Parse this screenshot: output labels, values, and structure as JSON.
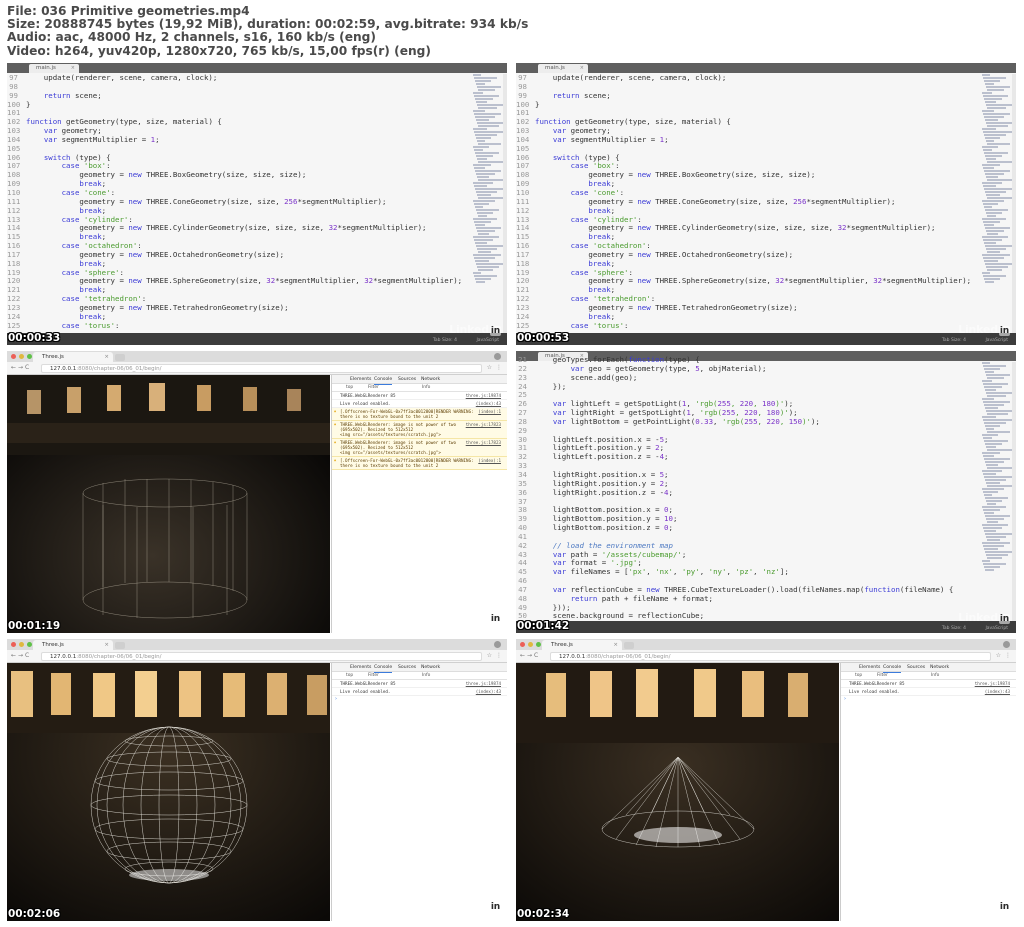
{
  "header": {
    "line1": "File: 036 Primitive geometries.mp4",
    "line2": "Size: 20888745 bytes (19,92 MiB), duration: 00:02:59, avg.bitrate: 934 kb/s",
    "line3": "Audio: aac, 48000 Hz, 2 channels, s16, 160 kb/s (eng)",
    "line4": "Video: h264, yuv420p, 1280x720, 765 kb/s, 15,00 fps(r) (eng)"
  },
  "watermark": {
    "text": "Linked",
    "badge": "in"
  },
  "editor": {
    "tab_label": "main.js",
    "status_left": "Tab Size: 4",
    "status_right": "JavaScript"
  },
  "browser": {
    "tab_label": "Three.js",
    "url_host": "127.0.0.1",
    "url_path": ":8080/chapter-06/06_01/begin/",
    "dev_tabs": [
      "Elements",
      "Console",
      "Sources",
      "Network"
    ],
    "filter_context": "top",
    "filter_placeholder": "Filter",
    "filter_level": "Info",
    "log_renderer": "THREE.WebGLRenderer 85",
    "log_renderer_src": "three.js:19874",
    "log_reload": "Live reload enabled.",
    "log_reload_src": "(index):43"
  },
  "thumbs": [
    {
      "timestamp": "00:00:33"
    },
    {
      "timestamp": "00:00:53"
    },
    {
      "timestamp": "00:01:19"
    },
    {
      "timestamp": "00:01:42"
    },
    {
      "timestamp": "00:02:06"
    },
    {
      "timestamp": "00:02:34"
    }
  ],
  "code_a": [
    {
      "n": "97",
      "t": "    update(renderer, scene, camera, clock);"
    },
    {
      "n": "98",
      "t": ""
    },
    {
      "n": "99",
      "t": "    return scene;"
    },
    {
      "n": "100",
      "t": "}"
    },
    {
      "n": "101",
      "t": ""
    },
    {
      "n": "102",
      "t": "function getGeometry(type, size, material) {"
    },
    {
      "n": "103",
      "t": "    var geometry;"
    },
    {
      "n": "104",
      "t": "    var segmentMultiplier = 1;"
    },
    {
      "n": "105",
      "t": ""
    },
    {
      "n": "106",
      "t": "    switch (type) {"
    },
    {
      "n": "107",
      "t": "        case 'box':"
    },
    {
      "n": "108",
      "t": "            geometry = new THREE.BoxGeometry(size, size, size);"
    },
    {
      "n": "109",
      "t": "            break;"
    },
    {
      "n": "110",
      "t": "        case 'cone':"
    },
    {
      "n": "111",
      "t": "            geometry = new THREE.ConeGeometry(size, size, 256*segmentMultiplier);"
    },
    {
      "n": "112",
      "t": "            break;"
    },
    {
      "n": "113",
      "t": "        case 'cylinder':"
    },
    {
      "n": "114",
      "t": "            geometry = new THREE.CylinderGeometry(size, size, size, 32*segmentMultiplier);"
    },
    {
      "n": "115",
      "t": "            break;"
    },
    {
      "n": "116",
      "t": "        case 'octahedron':"
    },
    {
      "n": "117",
      "t": "            geometry = new THREE.OctahedronGeometry(size);"
    },
    {
      "n": "118",
      "t": "            break;"
    },
    {
      "n": "119",
      "t": "        case 'sphere':"
    },
    {
      "n": "120",
      "t": "            geometry = new THREE.SphereGeometry(size, 32*segmentMultiplier, 32*segmentMultiplier);"
    },
    {
      "n": "121",
      "t": "            break;"
    },
    {
      "n": "122",
      "t": "        case 'tetrahedron':"
    },
    {
      "n": "123",
      "t": "            geometry = new THREE.TetrahedronGeometry(size);"
    },
    {
      "n": "124",
      "t": "            break;"
    },
    {
      "n": "125",
      "t": "        case 'torus':"
    }
  ],
  "code_b": [
    {
      "n": "21",
      "t": "    geoTypes.forEach(function(type) {"
    },
    {
      "n": "22",
      "t": "        var geo = getGeometry(type, 5, objMaterial);"
    },
    {
      "n": "23",
      "t": "        scene.add(geo);"
    },
    {
      "n": "24",
      "t": "    });"
    },
    {
      "n": "25",
      "t": ""
    },
    {
      "n": "26",
      "t": "    var lightLeft = getSpotLight(1, 'rgb(255, 220, 180)');"
    },
    {
      "n": "27",
      "t": "    var lightRight = getSpotLight(1, 'rgb(255, 220, 180)');"
    },
    {
      "n": "28",
      "t": "    var lightBottom = getPointLight(0.33, 'rgb(255, 220, 150)');"
    },
    {
      "n": "29",
      "t": ""
    },
    {
      "n": "30",
      "t": "    lightLeft.position.x = -5;"
    },
    {
      "n": "31",
      "t": "    lightLeft.position.y = 2;"
    },
    {
      "n": "32",
      "t": "    lightLeft.position.z = -4;"
    },
    {
      "n": "33",
      "t": ""
    },
    {
      "n": "34",
      "t": "    lightRight.position.x = 5;"
    },
    {
      "n": "35",
      "t": "    lightRight.position.y = 2;"
    },
    {
      "n": "36",
      "t": "    lightRight.position.z = -4;"
    },
    {
      "n": "37",
      "t": ""
    },
    {
      "n": "38",
      "t": "    lightBottom.position.x = 0;"
    },
    {
      "n": "39",
      "t": "    lightBottom.position.y = 10;"
    },
    {
      "n": "40",
      "t": "    lightBottom.position.z = 0;"
    },
    {
      "n": "41",
      "t": ""
    },
    {
      "n": "42",
      "t": "    // load the environment map"
    },
    {
      "n": "43",
      "t": "    var path = '/assets/cubemap/';"
    },
    {
      "n": "44",
      "t": "    var format = '.jpg';"
    },
    {
      "n": "45",
      "t": "    var fileNames = ['px', 'nx', 'py', 'ny', 'pz', 'nz'];"
    },
    {
      "n": "46",
      "t": ""
    },
    {
      "n": "47",
      "t": "    var reflectionCube = new THREE.CubeTextureLoader().load(fileNames.map(function(fileName) {"
    },
    {
      "n": "48",
      "t": "        return path + fileName + format;"
    },
    {
      "n": "49",
      "t": "    }));"
    },
    {
      "n": "50",
      "t": "    scene.background = reflectionCube;"
    }
  ],
  "warnings": [
    {
      "t": "[.Offscreen-For-WebGL-0x7ff3ac0012800]RENDER WARNING:\nthere is no texture bound to the unit 2",
      "src": "(index):1"
    },
    {
      "t": "THREE.WebGLRenderer: image is not power of two\n(695x502). Resized to 512x512\n<img src=\"/assets/textures/scratch.jpg\">",
      "src": "three.js:17823"
    },
    {
      "t": "THREE.WebGLRenderer: image is not power of two\n(695x502). Resized to 512x512\n<img src=\"/assets/textures/scratch.jpg\">",
      "src": "three.js:17823"
    },
    {
      "t": "[.Offscreen-For-WebGL-0x7ff3ac0012800]RENDER WARNING:\nthere is no texture bound to the unit 2",
      "src": "(index):1"
    }
  ]
}
